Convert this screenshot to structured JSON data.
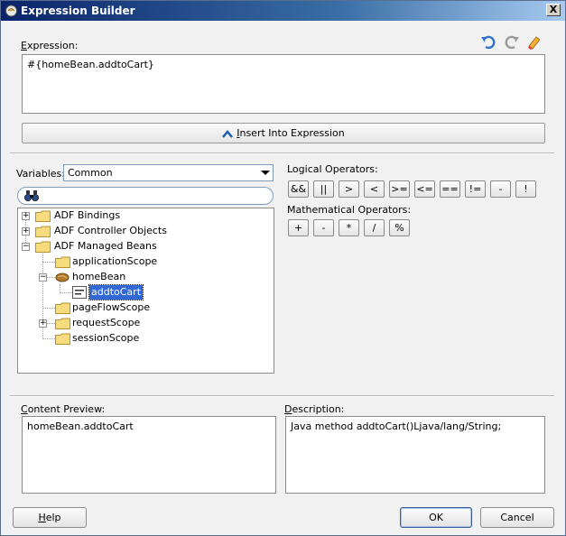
{
  "window": {
    "title": "Expression Builder",
    "close_glyph": "X"
  },
  "expression": {
    "label": "Expression:",
    "label_accel": "E",
    "label_rest": "xpression:",
    "value": "#{homeBean.addtoCart}"
  },
  "toolbar": {
    "undo_icon": "undo-icon",
    "redo_icon": "redo-icon",
    "clear_icon": "eraser-icon"
  },
  "insert_button": {
    "accel": "I",
    "rest": "nsert Into Expression"
  },
  "variables": {
    "label": "Variables:",
    "selected": "Common"
  },
  "tree": {
    "adf_bindings": "ADF Bindings",
    "adf_controller_objects": "ADF Controller Objects",
    "adf_managed_beans": "ADF Managed Beans",
    "application_scope": "applicationScope",
    "home_bean": "homeBean",
    "add_to_cart": "addtoCart",
    "page_flow_scope": "pageFlowScope",
    "request_scope": "requestScope",
    "session_scope": "sessionScope"
  },
  "logical_operators": {
    "label": "Logical Operators:",
    "ops": [
      "&&",
      "||",
      ">",
      "<",
      ">=",
      "<=",
      "==",
      "!=",
      "-",
      "!"
    ]
  },
  "mathematical_operators": {
    "label": "Mathematical Operators:",
    "ops": [
      "+",
      "-",
      "*",
      "/",
      "%"
    ]
  },
  "content_preview": {
    "label_accel": "C",
    "label_rest": "ontent Preview:",
    "value": "homeBean.addtoCart"
  },
  "description": {
    "label_accel": "D",
    "label_rest": "escription:",
    "value": "Java method addtoCart()Ljava/lang/String;"
  },
  "buttons": {
    "help_accel": "H",
    "help_rest": "elp",
    "ok": "OK",
    "cancel": "Cancel"
  }
}
